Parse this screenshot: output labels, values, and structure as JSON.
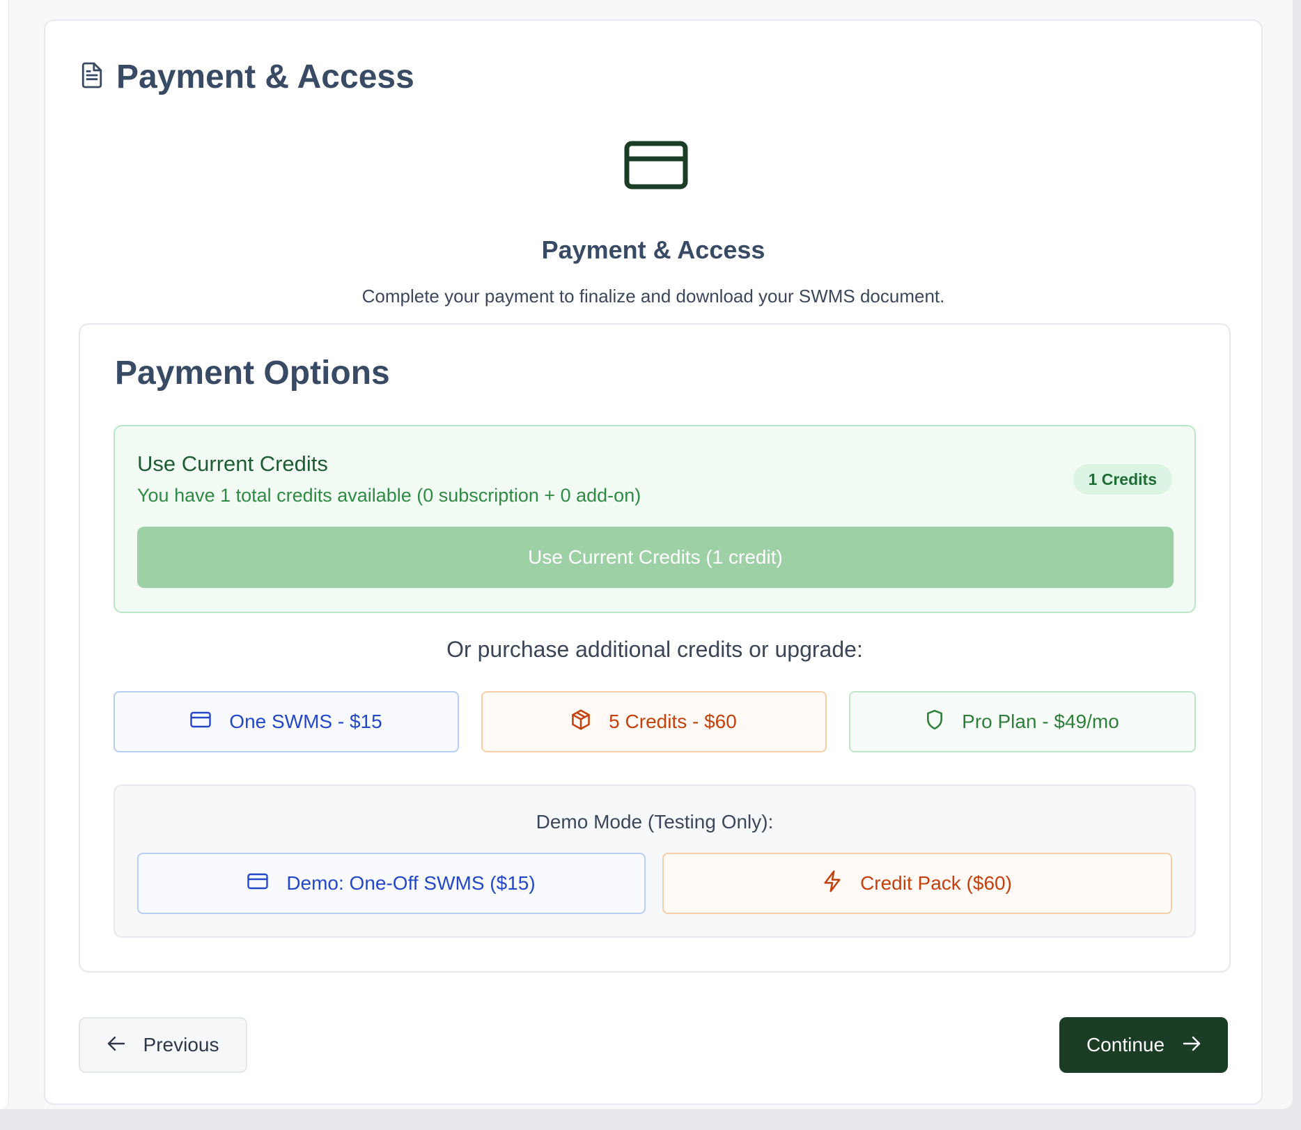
{
  "header": {
    "title": "Payment & Access",
    "title_icon": "document-icon"
  },
  "hero": {
    "icon": "credit-card-icon",
    "title": "Payment & Access",
    "subtitle": "Complete your payment to finalize and download your SWMS document."
  },
  "payment_options": {
    "title": "Payment Options",
    "credits": {
      "title": "Use Current Credits",
      "description": "You have 1 total credits available (0 subscription + 0 add-on)",
      "badge": "1 Credits",
      "button_label": "Use Current Credits (1 credit)"
    },
    "purchase_prompt": "Or purchase additional credits or upgrade:",
    "purchase_buttons": [
      {
        "label": "One SWMS - $15",
        "icon": "credit-card-icon"
      },
      {
        "label": "5 Credits - $60",
        "icon": "package-icon"
      },
      {
        "label": "Pro Plan - $49/mo",
        "icon": "shield-icon"
      }
    ],
    "demo": {
      "label": "Demo Mode (Testing Only):",
      "buttons": [
        {
          "label": "Demo: One-Off SWMS ($15)",
          "icon": "credit-card-icon"
        },
        {
          "label": "Credit Pack ($60)",
          "icon": "lightning-icon"
        }
      ]
    }
  },
  "navigation": {
    "previous_label": "Previous",
    "continue_label": "Continue"
  },
  "colors": {
    "primary_dark_green": "#1b3d26",
    "credits_button": "#9ed0a5",
    "blue_accent": "#2447c7",
    "orange_accent": "#c2410c",
    "green_accent": "#2f7f3c"
  }
}
